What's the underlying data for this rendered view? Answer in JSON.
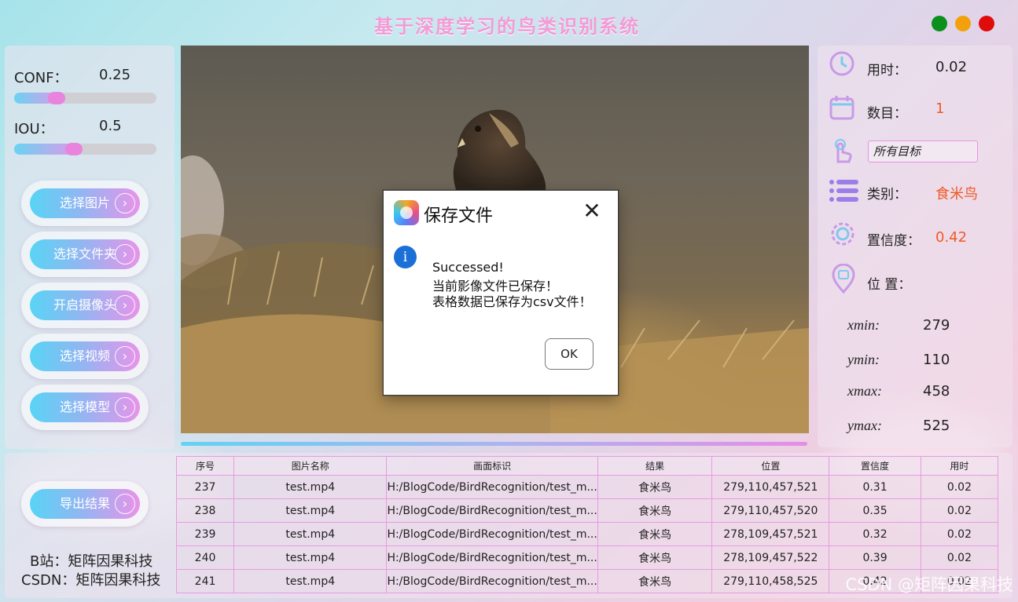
{
  "app": {
    "title": "基于深度学习的鸟类识别系统",
    "window_buttons": [
      "#0b8f1d",
      "#f2a10d",
      "#e00b0b"
    ]
  },
  "params": {
    "conf": {
      "label": "CONF：",
      "value": "0.25",
      "level": 0.25
    },
    "iou": {
      "label": "IOU：",
      "value": "0.5",
      "level": 0.5
    }
  },
  "buttons": {
    "select_image": "选择图片",
    "select_folder": "选择文件夹",
    "open_camera": "开启摄像头",
    "select_video": "选择视频",
    "select_model": "选择模型",
    "export": "导出结果",
    "chevron": "›"
  },
  "stats": {
    "time_label": "用时：",
    "time_value": "0.02",
    "count_label": "数目：",
    "count_value": "1",
    "target_select": "所有目标",
    "class_label": "类别：",
    "class_value": "食米鸟",
    "conf_label": "置信度：",
    "conf_value": "0.42",
    "pos_label": "位 置："
  },
  "coords": {
    "xmin_label": "xmin:",
    "xmin": "279",
    "ymin_label": "ymin:",
    "ymin": "110",
    "xmax_label": "xmax:",
    "xmax": "458",
    "ymax_label": "ymax:",
    "ymax": "525"
  },
  "table": {
    "headers": [
      "序号",
      "图片名称",
      "画面标识",
      "结果",
      "位置",
      "置信度",
      "用时"
    ],
    "rows": [
      [
        "237",
        "test.mp4",
        "H:/BlogCode/BirdRecognition/test_m...",
        "食米鸟",
        "279,110,457,521",
        "0.31",
        "0.02"
      ],
      [
        "238",
        "test.mp4",
        "H:/BlogCode/BirdRecognition/test_m...",
        "食米鸟",
        "279,110,457,520",
        "0.35",
        "0.02"
      ],
      [
        "239",
        "test.mp4",
        "H:/BlogCode/BirdRecognition/test_m...",
        "食米鸟",
        "278,109,457,521",
        "0.32",
        "0.02"
      ],
      [
        "240",
        "test.mp4",
        "H:/BlogCode/BirdRecognition/test_m...",
        "食米鸟",
        "278,109,457,522",
        "0.39",
        "0.02"
      ],
      [
        "241",
        "test.mp4",
        "H:/BlogCode/BirdRecognition/test_m...",
        "食米鸟",
        "279,110,458,525",
        "0.42",
        "0.02"
      ]
    ]
  },
  "brand": {
    "bilibili": "B站：矩阵因果科技",
    "csdn": "CSDN：矩阵因果科技",
    "watermark": "CSDN @矩阵因果科技"
  },
  "dialog": {
    "title": "保存文件",
    "close": "✕",
    "info_icon": "i",
    "line1": "Successed!",
    "line2": "当前影像文件已保存！",
    "line3": "表格数据已保存为csv文件！",
    "ok": "OK"
  },
  "colors": {
    "accent_pink": "#e893e9",
    "accent_cyan": "#58d4f5",
    "value_orange": "#ef5a24"
  }
}
